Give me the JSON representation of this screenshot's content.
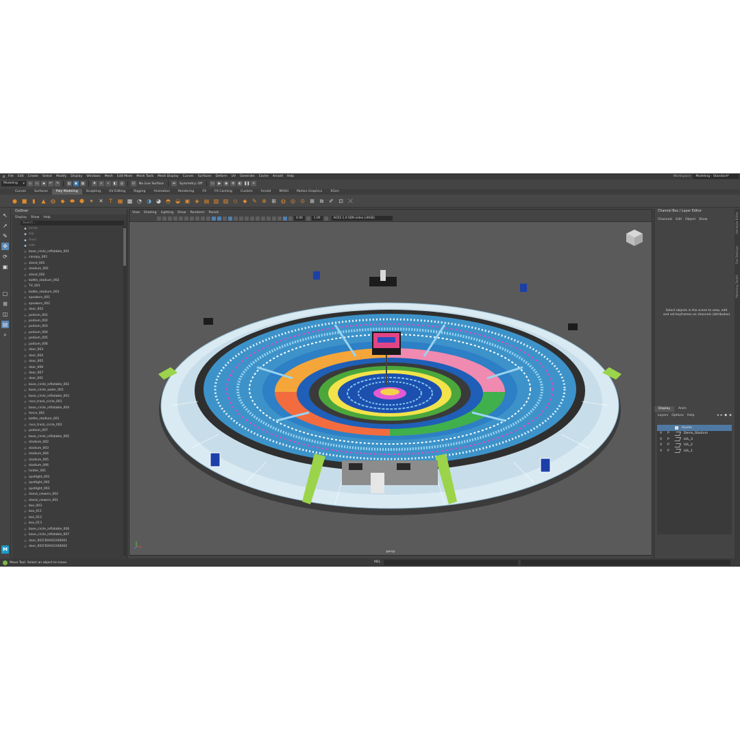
{
  "menubar": {
    "items": [
      "File",
      "Edit",
      "Create",
      "Select",
      "Modify",
      "Display",
      "Windows",
      "Mesh",
      "Edit Mesh",
      "Mesh Tools",
      "Mesh Display",
      "Curves",
      "Surfaces",
      "Deform",
      "UV",
      "Generate",
      "Cache",
      "Arnold",
      "Help"
    ],
    "workspace_label": "Workspace:",
    "workspace_value": "Modeling - Standard*"
  },
  "statusline": {
    "mode": "Modeling",
    "live_surface": "No Live Surface",
    "symmetry": "Symmetry: Off"
  },
  "shelf_tabs": {
    "items": [
      "Curves",
      "Surfaces",
      "Poly Modeling",
      "Sculpting",
      "UV Editing",
      "Rigging",
      "Animation",
      "Rendering",
      "FX",
      "FX Caching",
      "Custom",
      "Arnold",
      "MASH",
      "Motion Graphics",
      "XGen"
    ],
    "active": "Poly Modeling"
  },
  "outliner": {
    "title": "Outliner",
    "menu": [
      "Display",
      "Show",
      "Help"
    ],
    "search_placeholder": "Search...",
    "cameras": [
      "persp",
      "top",
      "front",
      "side"
    ],
    "items": [
      "base_circle_inflatable_001",
      "canopy_001",
      "stand_001",
      "stadium_001",
      "stand_002",
      "battle_stadium_002",
      "TV_001",
      "battle_stadium_003",
      "speakers_001",
      "speakers_002",
      "door_002",
      "podium_001",
      "podium_002",
      "podium_003",
      "podium_004",
      "podium_005",
      "podium_006",
      "door_003",
      "door_004",
      "door_005",
      "door_006",
      "door_007",
      "door_001",
      "base_circle_inflatable_002",
      "base_circle_water_001",
      "base_circle_inflatable_003",
      "race_track_circle_001",
      "base_circle_inflatable_004",
      "fence_001",
      "battle_stadium_001",
      "race_track_circle_002",
      "podium_007",
      "base_circle_inflatable_005",
      "stadium_002",
      "stadium_003",
      "stadium_004",
      "stadium_005",
      "stadium_006",
      "holder_001",
      "spotlight_001",
      "spotlight_002",
      "spotlight_003",
      "stand_viewers_002",
      "stand_viewers_001",
      "box_003",
      "box_011",
      "box_012",
      "box_013",
      "base_circle_inflatable_006",
      "base_circle_inflatable_007",
      "door_001FBXASC046001",
      "door_001FBXASC046002"
    ]
  },
  "viewport": {
    "menu": [
      "View",
      "Shading",
      "Lighting",
      "Show",
      "Renderer",
      "Panels"
    ],
    "exposure": "0.00",
    "gamma": "1.00",
    "color_space": "ACES 1.0 SDR-video (sRGB)",
    "camera_label": "persp"
  },
  "channel_box": {
    "title": "Channel Box / Layer Editor",
    "menu": [
      "Channels",
      "Edit",
      "Object",
      "Show"
    ],
    "hint": "Select objects in the scene to view, edit and set keyframes on channels (attributes)"
  },
  "layer_editor": {
    "tabs": [
      "Display",
      "Anim"
    ],
    "active_tab": "Display",
    "menu": [
      "Layers",
      "Options",
      "Help"
    ],
    "layers": [
      {
        "v": "",
        "p": "",
        "name": "Assets",
        "selected": true
      },
      {
        "v": "V",
        "p": "P",
        "name": "Demo_Stadium",
        "selected": false
      },
      {
        "v": "V",
        "p": "P",
        "name": "LVL_3",
        "selected": false
      },
      {
        "v": "V",
        "p": "P",
        "name": "LVL_2",
        "selected": false
      },
      {
        "v": "V",
        "p": "P",
        "name": "LVL_1",
        "selected": false
      }
    ]
  },
  "side_tabs": [
    "Attribute Editor",
    "Tool Settings",
    "Modeling Toolkit"
  ],
  "helpline": {
    "text": "Move Tool: Select an object to move.",
    "mel_label": "MEL"
  },
  "colors": {
    "accent": "#4f79a3",
    "shelf_icon": "#e08a2e",
    "viewport_bg": "#5a5a5a"
  }
}
